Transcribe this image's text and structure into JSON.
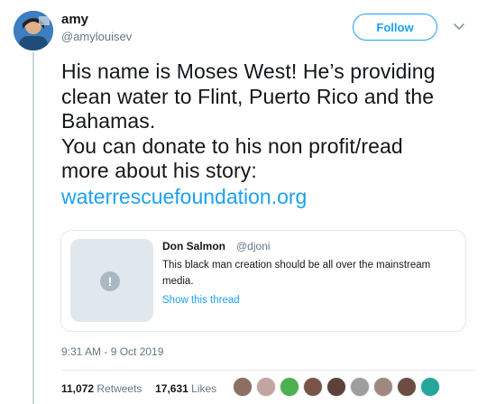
{
  "author": {
    "name": "amy",
    "handle": "@amylouisev"
  },
  "follow_label": "Follow",
  "tweet": {
    "text": "His name is Moses West! He’s providing\nclean water to Flint, Puerto Rico and the\nBahamas.\nYou can donate to his non profit/read\nmore about his story:",
    "link": "waterrescuefoundation.org"
  },
  "quote": {
    "name": "Don Salmon",
    "handle": "@djoni",
    "text": "This black man creation should be all over the mainstream media.",
    "show_thread": "Show this thread",
    "media_badge": "!"
  },
  "timestamp": "9:31 AM - 9 Oct 2019",
  "stats": {
    "retweets_count": "11,072",
    "retweets_label": "Retweets",
    "likes_count": "17,631",
    "likes_label": "Likes"
  },
  "colors": {
    "accent": "#1da1f2",
    "text": "#14171a",
    "muted": "#657786"
  },
  "likers": [
    {
      "icon": "liker-avatar-1",
      "color": "#8d6e63"
    },
    {
      "icon": "liker-avatar-2",
      "color": "#c2a4a0"
    },
    {
      "icon": "liker-avatar-3",
      "color": "#4caf50"
    },
    {
      "icon": "liker-avatar-4",
      "color": "#795548"
    },
    {
      "icon": "liker-avatar-5",
      "color": "#5d4037"
    },
    {
      "icon": "liker-avatar-6",
      "color": "#9e9e9e"
    },
    {
      "icon": "liker-avatar-7",
      "color": "#a1887f"
    },
    {
      "icon": "liker-avatar-8",
      "color": "#6d4c41"
    },
    {
      "icon": "liker-avatar-9",
      "color": "#26a69a"
    }
  ]
}
